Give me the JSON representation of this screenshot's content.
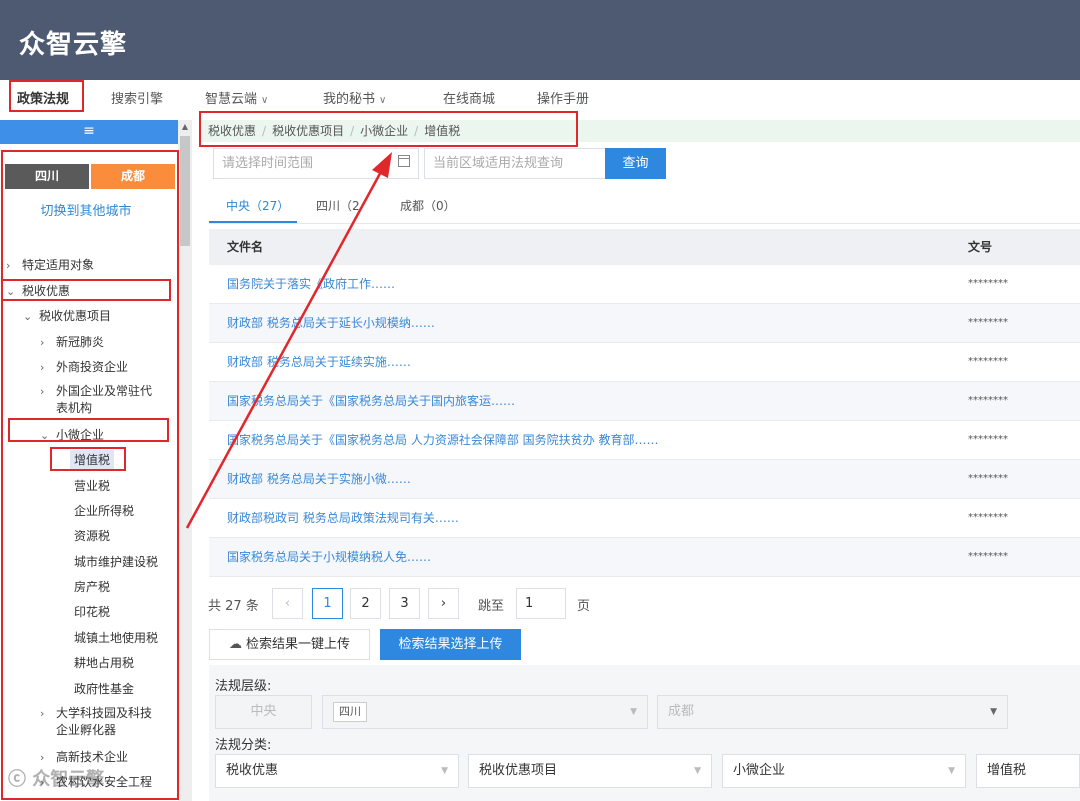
{
  "app": {
    "logo": "众智云擎"
  },
  "nav": {
    "items": [
      {
        "label": "政策法规",
        "active": true,
        "dropdown": false
      },
      {
        "label": "搜索引擎",
        "active": false,
        "dropdown": false
      },
      {
        "label": "智慧云端",
        "active": false,
        "dropdown": true
      },
      {
        "label": "我的秘书",
        "active": false,
        "dropdown": true
      },
      {
        "label": "在线商城",
        "active": false,
        "dropdown": false
      },
      {
        "label": "操作手册",
        "active": false,
        "dropdown": false
      }
    ]
  },
  "sidebar": {
    "toggle_icon": "menu-icon",
    "province": "四川",
    "city": "成都",
    "switch_city": "切换到其他城市",
    "tree": [
      {
        "label": "特定适用对象",
        "arrow": "›"
      },
      {
        "label": "税收优惠",
        "arrow": "⌄"
      },
      {
        "label": "税收优惠项目",
        "arrow": "⌄"
      },
      {
        "label": "新冠肺炎",
        "arrow": "›"
      },
      {
        "label": "外商投资企业",
        "arrow": "›"
      },
      {
        "label": "外国企业及常驻代",
        "label2": "表机构",
        "arrow": "›"
      },
      {
        "label": "小微企业",
        "arrow": "⌄"
      },
      {
        "label": "增值税"
      },
      {
        "label": "营业税"
      },
      {
        "label": "企业所得税"
      },
      {
        "label": "资源税"
      },
      {
        "label": "城市维护建设税"
      },
      {
        "label": "房产税"
      },
      {
        "label": "印花税"
      },
      {
        "label": "城镇土地使用税"
      },
      {
        "label": "耕地占用税"
      },
      {
        "label": "政府性基金"
      },
      {
        "label": "大学科技园及科技",
        "label2": "企业孵化器",
        "arrow": "›"
      },
      {
        "label": "高新技术企业",
        "arrow": "›"
      },
      {
        "label": "农村饮水安全工程",
        "arrow": "›"
      }
    ]
  },
  "breadcrumb": [
    "税收优惠",
    "税收优惠项目",
    "小微企业",
    "增值税"
  ],
  "search": {
    "date_placeholder": "请选择时间范围",
    "query_placeholder": "当前区域适用法规查询",
    "query_button": "查询"
  },
  "tabs": [
    {
      "label": "中央（27）",
      "active": true
    },
    {
      "label": "四川（2",
      "active": false
    },
    {
      "label": "成都（0）",
      "active": false
    }
  ],
  "table": {
    "headers": [
      "文件名",
      "文号"
    ],
    "rows": [
      {
        "name": "国务院关于落实《政府工作……",
        "no": "********"
      },
      {
        "name": "财政部 税务总局关于延长小规模纳……",
        "no": "********"
      },
      {
        "name": "财政部 税务总局关于延续实施……",
        "no": "********"
      },
      {
        "name": "国家税务总局关于《国家税务总局关于国内旅客运……",
        "no": "********"
      },
      {
        "name": "国家税务总局关于《国家税务总局 人力资源社会保障部 国务院扶贫办 教育部……",
        "no": "********"
      },
      {
        "name": "财政部 税务总局关于实施小微……",
        "no": "********"
      },
      {
        "name": "财政部税政司 税务总局政策法规司有关……",
        "no": "********"
      },
      {
        "name": "国家税务总局关于小规模纳税人免……",
        "no": "********"
      }
    ]
  },
  "pagination": {
    "total": "共 27 条",
    "prev": "‹",
    "next": "›",
    "pages": [
      "1",
      "2",
      "3"
    ],
    "current_page": "1",
    "jump_label": "跳至",
    "jump_value": "1",
    "page_label": "页"
  },
  "actions": {
    "upload_all": "检索结果一键上传",
    "upload_selected": "检索结果选择上传"
  },
  "filters": {
    "level_label": "法规层级:",
    "level_central": "中央",
    "level_province": "四川",
    "level_city": "成都",
    "category_label": "法规分类:",
    "categories": [
      "税收优惠",
      "税收优惠项目",
      "小微企业",
      "增值税"
    ]
  },
  "watermark": "众智云擎",
  "colors": {
    "header": "#4e5a72",
    "accent": "#2f88e0",
    "highlight": "#e0272c",
    "city": "#fb8c3b"
  }
}
